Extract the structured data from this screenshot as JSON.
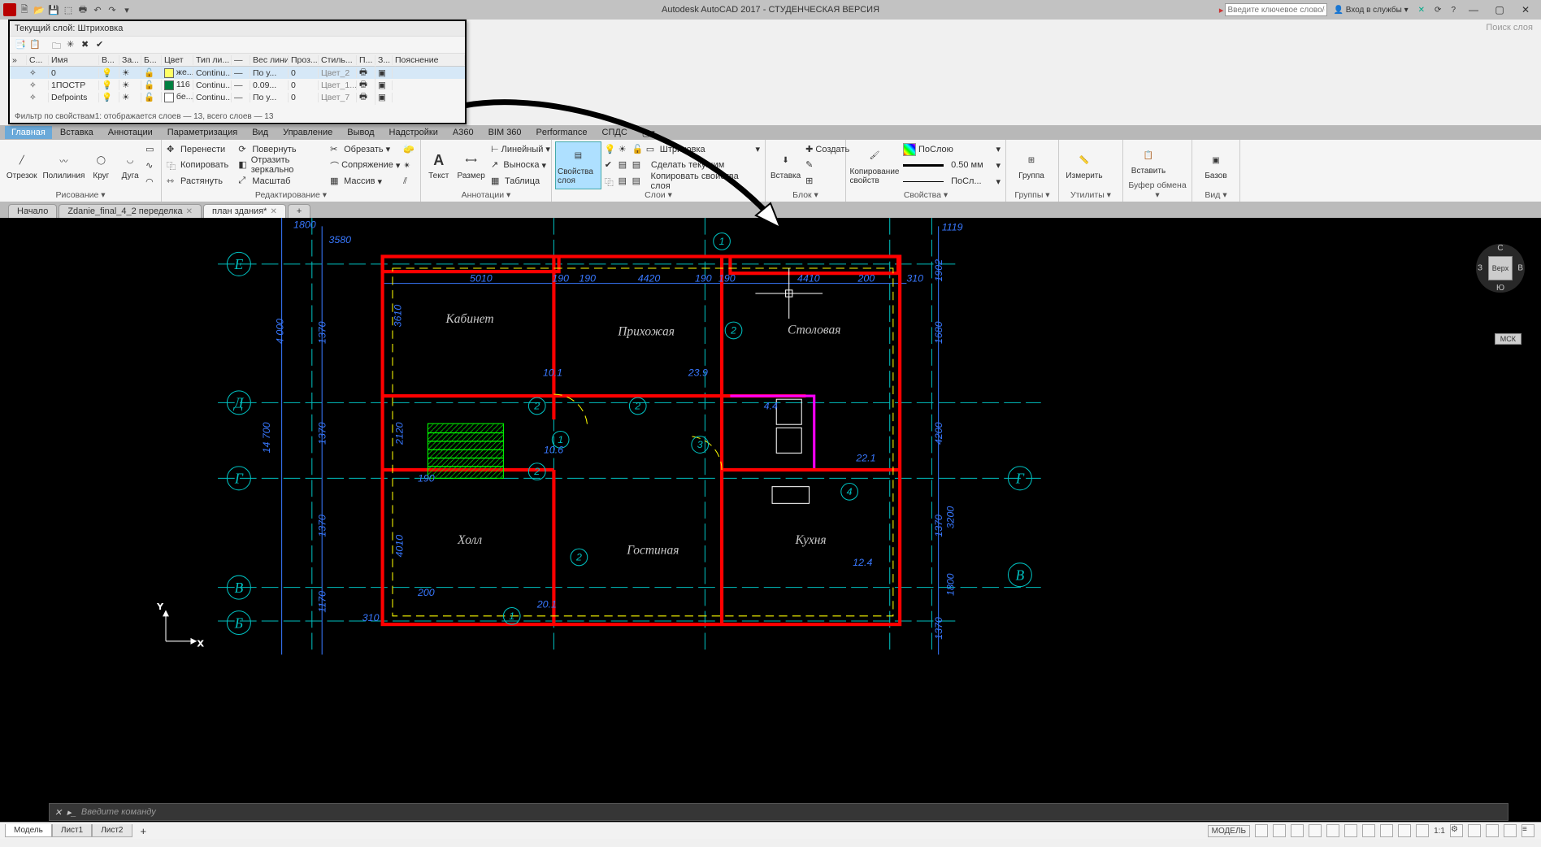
{
  "titlebar": {
    "app_title": "Autodesk AutoCAD 2017 - СТУДЕНЧЕСКАЯ ВЕРСИЯ",
    "search_placeholder": "Введите ключевое слово/фразу",
    "signin_label": "Вход в службы",
    "help_icon": "?"
  },
  "layer_panel": {
    "title": "Текущий слой: Штриховка",
    "columns": {
      "s": "С...",
      "name": "Имя",
      "on": "В...",
      "freeze": "За...",
      "lock": "Б...",
      "color": "Цвет",
      "linetype": "Тип ли...",
      "lw_dash": "—",
      "lineweight": "Вес линий",
      "trans": "Проз...",
      "style": "Стиль...",
      "print": "П...",
      "z": "З...",
      "expl": "Пояснение"
    },
    "rows": [
      {
        "name": "0",
        "color_name": "же...",
        "swatch": "#ffff66",
        "linetype": "Continu...",
        "lineweight": "По у...",
        "trans": "0",
        "style": "Цвет_2"
      },
      {
        "name": "1ПОСТР",
        "color_name": "116",
        "swatch": "#008040",
        "linetype": "Continu...",
        "lineweight": "0.09...",
        "trans": "0",
        "style": "Цвет_1..."
      },
      {
        "name": "Defpoints",
        "color_name": "бе...",
        "swatch": "#ffffff",
        "linetype": "Continu...",
        "lineweight": "По у...",
        "trans": "0",
        "style": "Цвет_7"
      }
    ],
    "footer": "Фильтр по свойствам1: отображается слоев — 13, всего слоев — 13"
  },
  "layer_search": "Поиск слоя",
  "menus": [
    "Главная",
    "Вставка",
    "Аннотации",
    "Параметризация",
    "Вид",
    "Управление",
    "Вывод",
    "Надстройки",
    "A360",
    "BIM 360",
    "Performance",
    "СПДС"
  ],
  "ribbon": {
    "draw": {
      "otrezok": "Отрезок",
      "poliliniya": "Полилиния",
      "krug": "Круг",
      "duga": "Дуга",
      "name": "Рисование ▾"
    },
    "edit": {
      "move": "Перенести",
      "copy": "Копировать",
      "stretch": "Растянуть",
      "rotate": "Повернуть",
      "mirror": "Отразить зеркально",
      "scale": "Масштаб",
      "trim": "Обрезать",
      "fillet": "Сопряжение",
      "array": "Массив",
      "name": "Редактирование ▾"
    },
    "annot": {
      "text": "Текст",
      "dim": "Размер",
      "linear": "Линейный",
      "leader": "Выноска",
      "table": "Таблица",
      "name": "Аннотации ▾"
    },
    "layers": {
      "props": "Свойства слоя",
      "hatch": "Штриховка",
      "current": "Сделать текущим",
      "copyprops": "Копировать свойства слоя",
      "name": "Слои ▾"
    },
    "block": {
      "insert": "Вставка",
      "create": "Создать",
      "name": "Блок ▾"
    },
    "props": {
      "match": "Копирование свойств",
      "bylayer": "ПоСлою",
      "lw": "0.50 мм",
      "lt": "ПоСл...",
      "name": "Свойства ▾"
    },
    "groups": {
      "group": "Группа",
      "name": "Группы ▾"
    },
    "utils": {
      "measure": "Измерить",
      "name": "Утилиты ▾"
    },
    "clip": {
      "paste": "Вставить",
      "name": "Буфер обмена ▾"
    },
    "view": {
      "base": "Базов",
      "name": "Вид ▾"
    }
  },
  "tabs": [
    {
      "label": "Начало",
      "active": false
    },
    {
      "label": "Zdanie_final_4_2 переделка",
      "active": false,
      "closeable": true
    },
    {
      "label": "план здания*",
      "active": true,
      "closeable": true
    }
  ],
  "viewcube": {
    "top": "Верх",
    "n": "С",
    "s": "Ю",
    "e": "В",
    "w": "З",
    "msk": "МСК"
  },
  "drawing": {
    "axis_labels": [
      "Е",
      "Д",
      "Г",
      "В",
      "Б",
      "Г",
      "В"
    ],
    "room_labels": {
      "kabinet": "Кабинет",
      "prihozhaya": "Прихожая",
      "stolovaya": "Столовая",
      "holl": "Холл",
      "gostinaya": "Гостиная",
      "kuhnya": "Кухня"
    },
    "dims_top": [
      "5010",
      "190",
      "190",
      "4420",
      "190",
      "190",
      "4410",
      "200",
      "310"
    ],
    "dims_left": [
      "1800",
      "3580",
      "4 000",
      "1370",
      "3610",
      "14 700",
      "1370",
      "2120",
      "190",
      "1370",
      "4010",
      "200",
      "1170",
      "310"
    ],
    "dims_right": [
      "1119",
      "1902",
      "1680",
      "4200",
      "3200",
      "1370",
      "1800",
      "1370"
    ],
    "dims_inner": [
      "10.1",
      "23.9",
      "4.4",
      "10.6",
      "22.1",
      "20.1",
      "12.4"
    ],
    "bubbles": [
      "1",
      "2",
      "2",
      "2",
      "3",
      "4",
      "2",
      "1",
      "1"
    ]
  },
  "cmdline": {
    "prompt": "Введите команду"
  },
  "statusbar": {
    "tabs": [
      "Модель",
      "Лист1",
      "Лист2"
    ],
    "model": "МОДЕЛЬ",
    "scale": "1:1"
  }
}
